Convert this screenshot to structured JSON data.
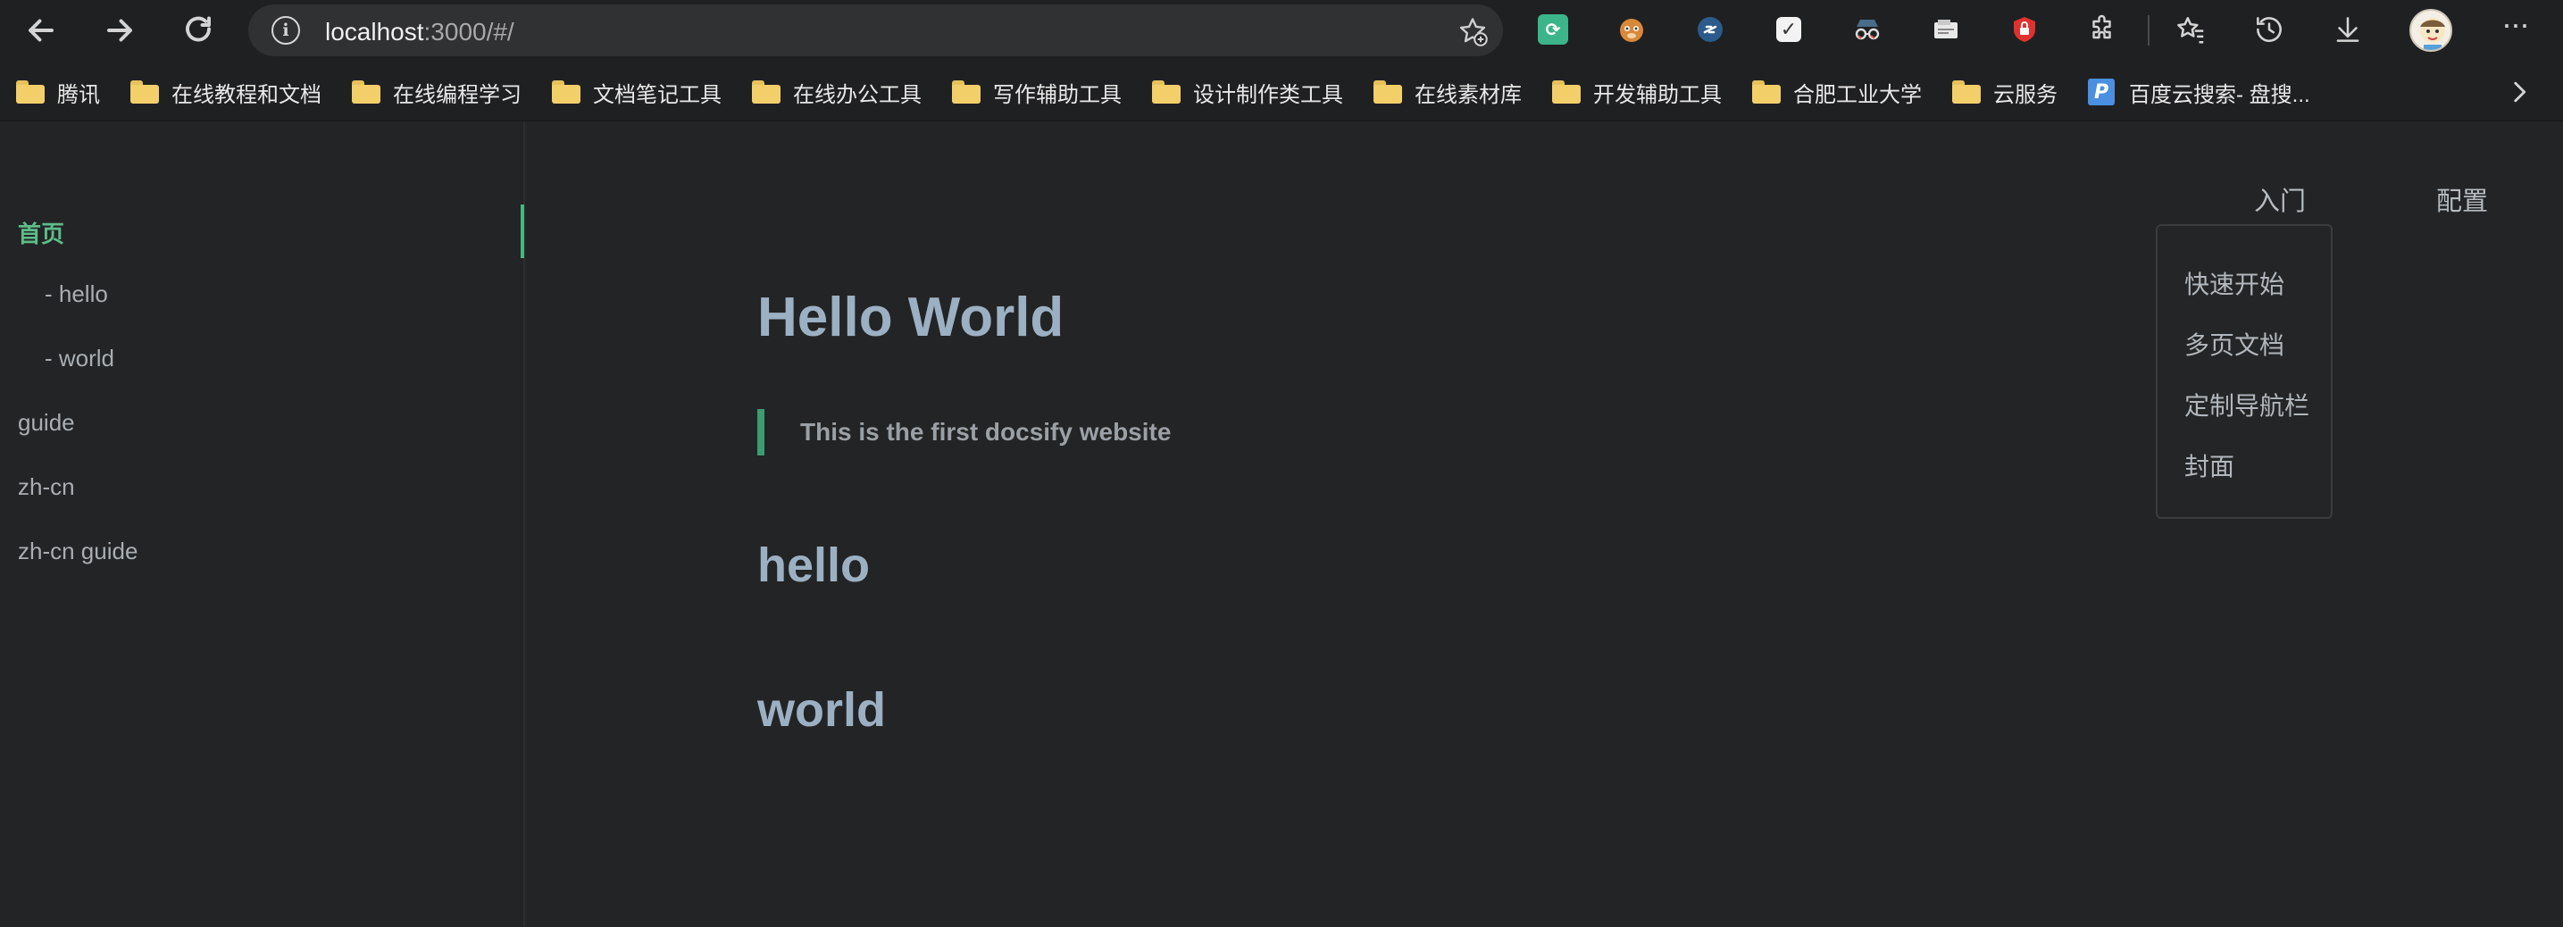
{
  "browser": {
    "url_host": "localhost",
    "url_rest": ":3000/#/",
    "bookmarks": [
      {
        "label": "腾讯",
        "type": "folder"
      },
      {
        "label": "在线教程和文档",
        "type": "folder"
      },
      {
        "label": "在线编程学习",
        "type": "folder"
      },
      {
        "label": "文档笔记工具",
        "type": "folder"
      },
      {
        "label": "在线办公工具",
        "type": "folder"
      },
      {
        "label": "写作辅助工具",
        "type": "folder"
      },
      {
        "label": "设计制作类工具",
        "type": "folder"
      },
      {
        "label": "在线素材库",
        "type": "folder"
      },
      {
        "label": "开发辅助工具",
        "type": "folder"
      },
      {
        "label": "合肥工业大学",
        "type": "folder"
      },
      {
        "label": "云服务",
        "type": "folder"
      },
      {
        "label": "百度云搜索- 盘搜...",
        "type": "link",
        "icon": "P"
      }
    ],
    "extensions": [
      "refresh-ext-icon",
      "tampermonkey-icon",
      "link-ext-icon",
      "checkbox-ext-icon",
      "incognito-ext-icon",
      "note-ext-icon",
      "shield-ext-icon",
      "puzzle-icon"
    ]
  },
  "sidebar": {
    "items": [
      {
        "label": "首页",
        "active": true
      },
      {
        "label": "- hello",
        "sub": true
      },
      {
        "label": "- world",
        "sub": true
      },
      {
        "label": "guide"
      },
      {
        "label": "zh-cn"
      },
      {
        "label": "zh-cn guide"
      }
    ]
  },
  "topnav": {
    "items": [
      "入门",
      "配置"
    ],
    "dropdown": [
      "快速开始",
      "多页文档",
      "定制导航栏",
      "封面"
    ]
  },
  "content": {
    "title": "Hello World",
    "quote": "This is the first docsify website",
    "h2_1": "hello",
    "h2_2": "world"
  },
  "colors": {
    "accent": "#42b983",
    "background": "#242526",
    "heading": "#9cb0c3"
  }
}
